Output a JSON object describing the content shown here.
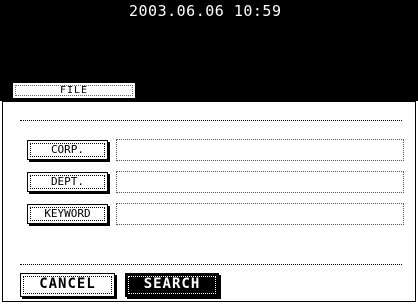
{
  "status_bar": {
    "datetime": "2003.06.06 10:59"
  },
  "tabs": [
    {
      "label": "FILE"
    }
  ],
  "search_form": {
    "fields": [
      {
        "label": "CORP.",
        "value": ""
      },
      {
        "label": "DEPT.",
        "value": ""
      },
      {
        "label": "KEYWORD",
        "value": ""
      }
    ]
  },
  "actions": {
    "cancel_label": "CANCEL",
    "search_label": "SEARCH"
  },
  "colors": {
    "background": "#ffffff",
    "header": "#000000",
    "text": "#000000"
  }
}
